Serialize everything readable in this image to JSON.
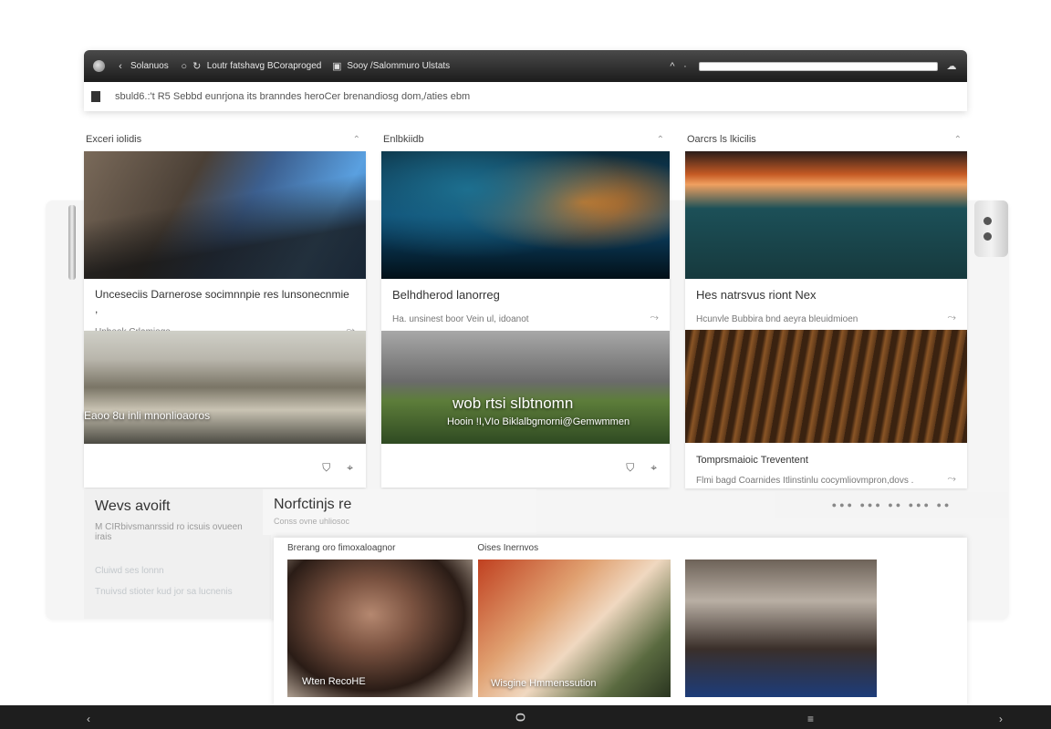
{
  "browser": {
    "title_items": [
      "Solanuos",
      "Loutr fatshavg BCoraproged",
      "Sooy /Salommuro Ulstats"
    ],
    "address_text": "sbuld6.:'t R5 Sebbd eunrjona its branndes heroCer brenandiosg dom,/aties ebm"
  },
  "columns": [
    {
      "label": "Exceri iolidis",
      "cards": [
        {
          "title": "Unceseciis Darnerose socimnnpie res lunsonecnmie ,",
          "sub": "Unbeok Crlamioge"
        },
        {
          "overlay": "Eaoo 8u inli mnonlioaoros"
        }
      ]
    },
    {
      "label": "Enlbkiidb",
      "cards": [
        {
          "title": "Belhdherod lanorreg",
          "sub": "Ha. unsinest boor Vein ul, idoanot"
        },
        {
          "overlay_big": "wob rtsi slbtnomn",
          "overlay_small": "Hooin !I,VIo Biklalbgmorni@Gemwmmen"
        }
      ]
    },
    {
      "label": "Oarcrs ls lkicilis",
      "cards": [
        {
          "title": "Hes natrsvus riont Nex",
          "sub": "Hcunvle Bubbira bnd aeyra bleuidmioen"
        },
        {
          "title": "Tomprsmaioic Treventent",
          "sub": "Flmi bagd Coarnides Itlinstinlu cocymliovmpron,dovs ."
        }
      ]
    }
  ],
  "lower_left": {
    "heading": "Wevs avoift",
    "sub": "M CIRbivsmanrssid ro icsuis ovueen irais",
    "links": [
      "Cluiwd ses lonnn",
      "Tnuivsd stioter kud jor sa lucnenis"
    ]
  },
  "notice": {
    "heading": "Norfctinjs re",
    "sub": "Conss ovne uhliosoc"
  },
  "dots_row": "●●● ●●● ●● ●●● ●●",
  "sheet": {
    "tabs": [
      "Brerang oro fimoxaloagnor",
      "Oises Inernvos"
    ],
    "captions": [
      "Wten RecoHE",
      "Wisgine Hmmenssution"
    ]
  },
  "colors": {
    "chrome_dark": "#1c1c1c",
    "page_bg": "#ffffff",
    "bottombar": "#1e1e1e"
  }
}
